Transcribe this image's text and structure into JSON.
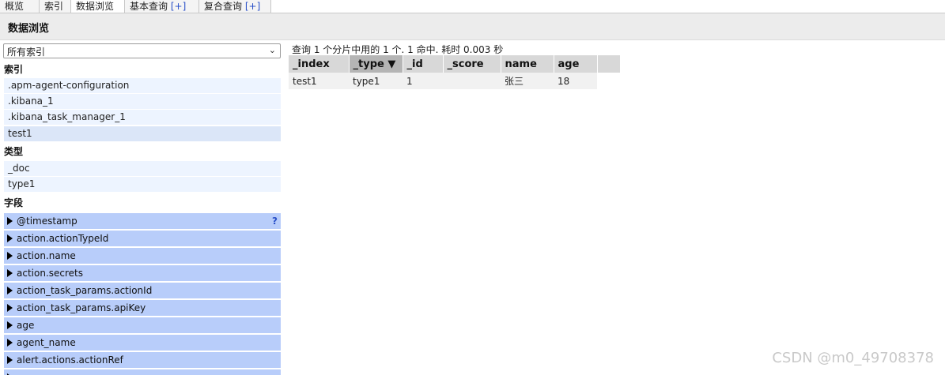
{
  "tabs": [
    {
      "label": "概览"
    },
    {
      "label": "索引"
    },
    {
      "label": "数据浏览"
    },
    {
      "label": "基本查询",
      "plus": "[+]"
    },
    {
      "label": "复合查询",
      "plus": "[+]"
    }
  ],
  "header": {
    "title": "数据浏览"
  },
  "sidebar": {
    "index_select": {
      "value": "所有索引"
    },
    "indices_heading": "索引",
    "indices": [
      ".apm-agent-configuration",
      ".kibana_1",
      ".kibana_task_manager_1",
      "test1"
    ],
    "types_heading": "类型",
    "types": [
      "_doc",
      "type1"
    ],
    "fields_heading": "字段",
    "fields": [
      "@timestamp",
      "action.actionTypeId",
      "action.name",
      "action.secrets",
      "action_task_params.actionId",
      "action_task_params.apiKey",
      "age",
      "agent_name",
      "alert.actions.actionRef"
    ],
    "help_icon": "?"
  },
  "main": {
    "summary": "查询 1 个分片中用的 1 个. 1 命中. 耗时 0.003 秒",
    "columns": [
      "_index",
      "_type ▼",
      "_id",
      "_score",
      "name",
      "age"
    ],
    "rows": [
      [
        "test1",
        "type1",
        "1",
        "",
        "张三",
        "18"
      ]
    ]
  },
  "watermark": "CSDN @m0_49708378"
}
